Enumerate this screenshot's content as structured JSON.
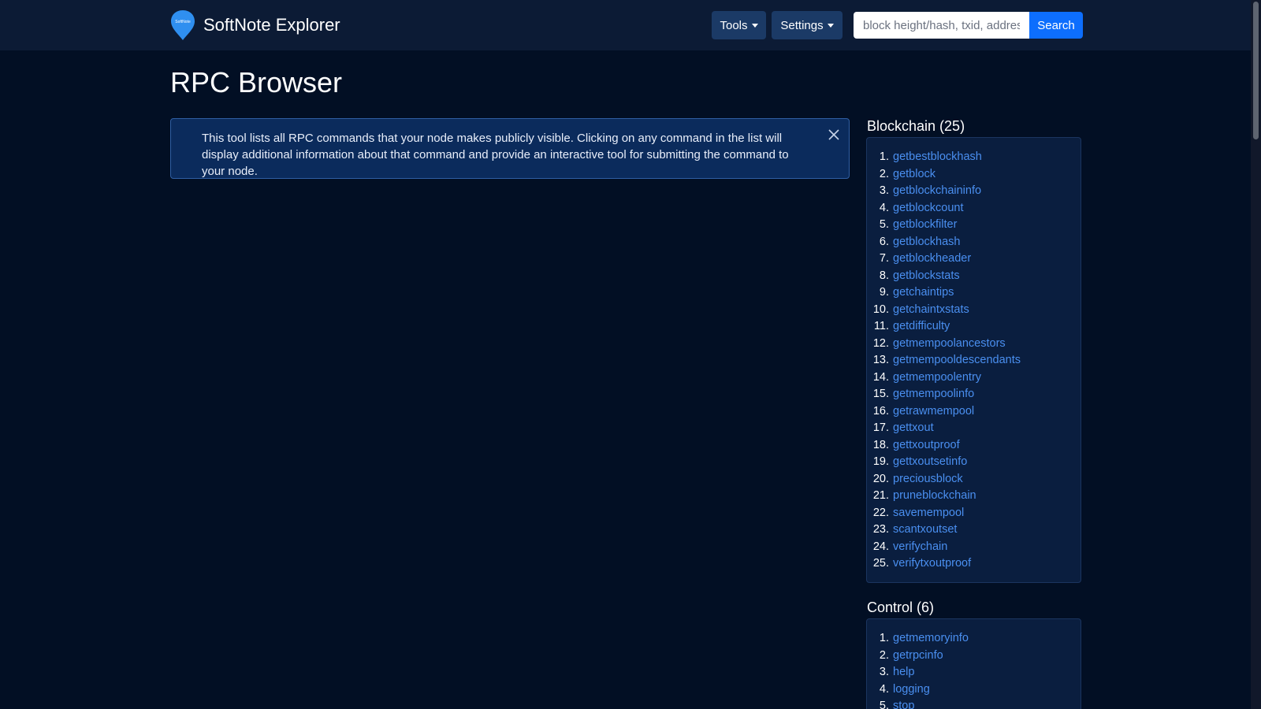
{
  "brand": {
    "logo_text": "SoftNote",
    "name": "SoftNote Explorer"
  },
  "nav": {
    "tools_label": "Tools",
    "settings_label": "Settings",
    "search_placeholder": "block height/hash, txid, address",
    "search_label": "Search"
  },
  "page": {
    "title": "RPC Browser",
    "alert_text": "This tool lists all RPC commands that your node makes publicly visible. Clicking on any command in the list will display additional information about that command and provide an interactive tool for submitting the command to your node."
  },
  "sections": [
    {
      "title": "Blockchain (25)",
      "commands": [
        {
          "num": "1.",
          "name": "getbestblockhash"
        },
        {
          "num": "2.",
          "name": "getblock"
        },
        {
          "num": "3.",
          "name": "getblockchaininfo"
        },
        {
          "num": "4.",
          "name": "getblockcount"
        },
        {
          "num": "5.",
          "name": "getblockfilter"
        },
        {
          "num": "6.",
          "name": "getblockhash"
        },
        {
          "num": "7.",
          "name": "getblockheader"
        },
        {
          "num": "8.",
          "name": "getblockstats"
        },
        {
          "num": "9.",
          "name": "getchaintips"
        },
        {
          "num": "10.",
          "name": "getchaintxstats"
        },
        {
          "num": "11.",
          "name": "getdifficulty"
        },
        {
          "num": "12.",
          "name": "getmempoolancestors"
        },
        {
          "num": "13.",
          "name": "getmempooldescendants"
        },
        {
          "num": "14.",
          "name": "getmempoolentry"
        },
        {
          "num": "15.",
          "name": "getmempoolinfo"
        },
        {
          "num": "16.",
          "name": "getrawmempool"
        },
        {
          "num": "17.",
          "name": "gettxout"
        },
        {
          "num": "18.",
          "name": "gettxoutproof"
        },
        {
          "num": "19.",
          "name": "gettxoutsetinfo"
        },
        {
          "num": "20.",
          "name": "preciousblock"
        },
        {
          "num": "21.",
          "name": "pruneblockchain"
        },
        {
          "num": "22.",
          "name": "savemempool"
        },
        {
          "num": "23.",
          "name": "scantxoutset"
        },
        {
          "num": "24.",
          "name": "verifychain"
        },
        {
          "num": "25.",
          "name": "verifytxoutproof"
        }
      ]
    },
    {
      "title": "Control (6)",
      "commands": [
        {
          "num": "1.",
          "name": "getmemoryinfo"
        },
        {
          "num": "2.",
          "name": "getrpcinfo"
        },
        {
          "num": "3.",
          "name": "help"
        },
        {
          "num": "4.",
          "name": "logging"
        },
        {
          "num": "5.",
          "name": "stop"
        }
      ]
    }
  ],
  "colors": {
    "background": "#020f24",
    "navbar": "#0c1b35",
    "link": "#4a8ff0",
    "search_button": "#0d6efd",
    "alert_bg": "#0b2b5c"
  }
}
